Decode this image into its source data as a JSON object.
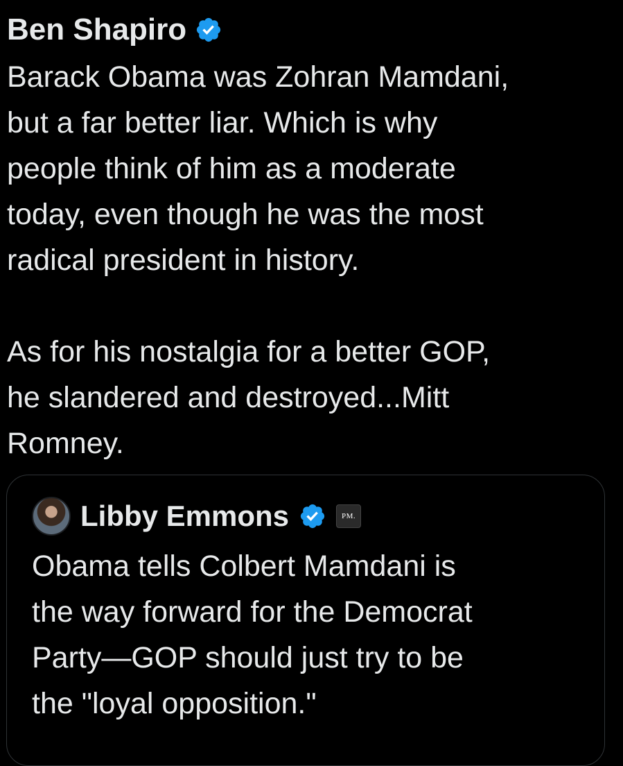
{
  "tweet": {
    "author_name": "Ben Shapiro",
    "verified_icon": "verified-badge-icon",
    "body_text": "Barack Obama was Zohran Mamdani,\nbut a far better liar. Which is why\npeople think of him as a moderate\ntoday, even though he was the most\nradical president in history.\n\nAs for his nostalgia for a better GOP,\nhe slandered and destroyed...Mitt\nRomney."
  },
  "quoted_tweet": {
    "author_name": "Libby Emmons",
    "verified_icon": "verified-badge-icon",
    "affiliate_badge_text": "PM.",
    "body_text": "Obama tells Colbert Mamdani is\nthe way forward for the Democrat\nParty—GOP should just try to be\nthe \"loyal opposition.\""
  },
  "colors": {
    "background": "#000000",
    "text": "#e7e9ea",
    "verified_blue": "#1d9bf0",
    "card_border": "#2f3336"
  }
}
